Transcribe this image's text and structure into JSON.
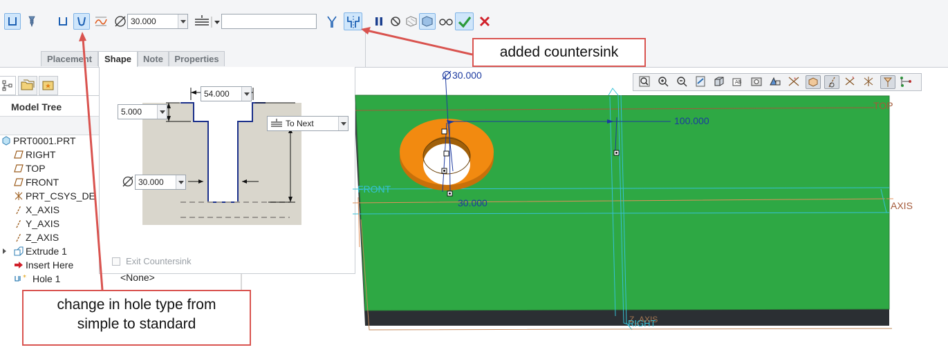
{
  "ribbon": {
    "diameter_value": "30.000",
    "depth_input_value": "",
    "tabs": [
      "Placement",
      "Shape",
      "Note",
      "Properties"
    ],
    "active_tab": "Shape",
    "icons": [
      "hole-simple-icon",
      "hole-standard-icon",
      "countersink-toggle-icon",
      "counterbore-toggle-icon",
      "sketch-profile-icon",
      "diameter-icon",
      "depth-option-icon",
      "tap-icon",
      "add-countersink-icon",
      "pause-icon",
      "no-preview-icon",
      "preview-icon",
      "verify-icon",
      "glasses-icon",
      "ok-check-icon",
      "cancel-x-icon"
    ]
  },
  "left_panel": {
    "title": "Model Tree",
    "items": [
      {
        "label": "PRT0001.PRT",
        "icon": "part-icon"
      },
      {
        "label": "RIGHT",
        "icon": "datum-plane-icon"
      },
      {
        "label": "TOP",
        "icon": "datum-plane-icon"
      },
      {
        "label": "FRONT",
        "icon": "datum-plane-icon"
      },
      {
        "label": "PRT_CSYS_DE",
        "icon": "csys-icon"
      },
      {
        "label": "X_AXIS",
        "icon": "axis-icon"
      },
      {
        "label": "Y_AXIS",
        "icon": "axis-icon"
      },
      {
        "label": "Z_AXIS",
        "icon": "axis-icon"
      },
      {
        "label": "Extrude 1",
        "icon": "extrude-icon"
      },
      {
        "label": "Insert Here",
        "icon": "insert-arrow-icon"
      },
      {
        "label": "Hole 1",
        "icon": "hole-icon"
      }
    ],
    "hole_note": "<None>"
  },
  "shape_panel": {
    "top_diameter": "54.000",
    "cs_depth": "5.000",
    "hole_diameter": "30.000",
    "depth_option": "To Next",
    "exit_countersink_label": "Exit Countersink"
  },
  "viewport": {
    "dim_diameter_top": "30.000",
    "dim_distance": "100.000",
    "dim_diameter_bottom": "30.000",
    "datum_labels": {
      "top": "TOP",
      "front": "FRONT",
      "axis": "AXIS",
      "right": "RIGHT",
      "z_axis": "Z_AXIS"
    },
    "colors": {
      "plate_top": "#2ea844",
      "plate_side": "#2b2f33",
      "countersink": "#f28a10",
      "datum": "#36c2d6",
      "dimension": "#1c3aa0"
    }
  },
  "callouts": {
    "countersink": "added countersink",
    "hole_type": "change in hole type from simple to standard"
  }
}
